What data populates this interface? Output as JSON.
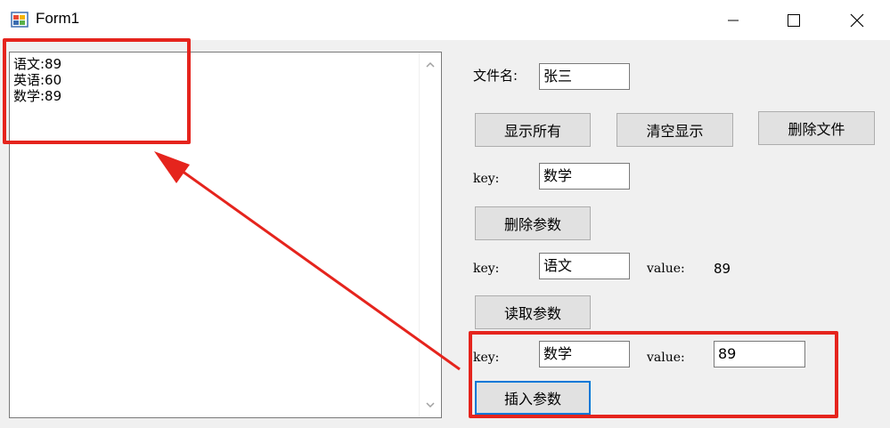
{
  "window": {
    "title": "Form1"
  },
  "textbox": {
    "lines": [
      "语文:89",
      "英语:60",
      "数学:89"
    ]
  },
  "file": {
    "label": "文件名:",
    "value": "张三"
  },
  "buttons": {
    "show_all": "显示所有",
    "clear_display": "清空显示",
    "delete_file": "删除文件",
    "delete_param": "删除参数",
    "read_param": "读取参数",
    "insert_param": "插入参数"
  },
  "delete_section": {
    "key_label": "key:",
    "key_value": "数学"
  },
  "read_section": {
    "key_label": "key:",
    "key_value": "语文",
    "value_label": "value:",
    "value_text": "89"
  },
  "insert_section": {
    "key_label": "key:",
    "key_value": "数学",
    "value_label": "value:",
    "value_value": "89"
  },
  "colors": {
    "highlight": "#e5241d",
    "focus": "#0078d7"
  }
}
